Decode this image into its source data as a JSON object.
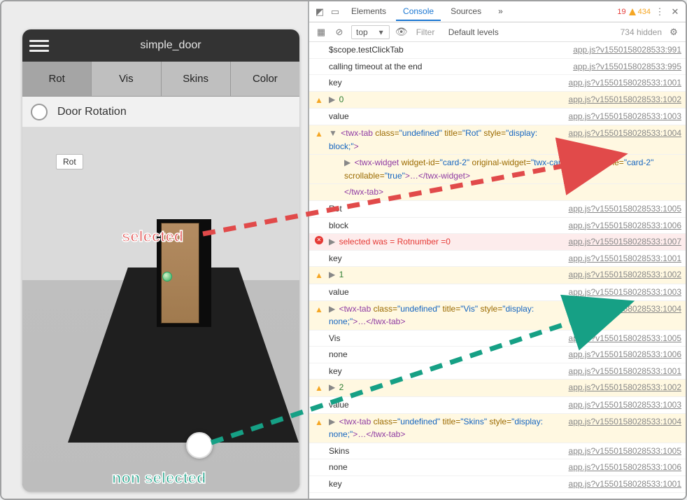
{
  "app": {
    "title": "simple_door",
    "tabs": [
      "Rot",
      "Vis",
      "Skins",
      "Color"
    ],
    "active_tab_index": 0,
    "section_label": "Door Rotation",
    "tooltip": "Rot"
  },
  "annotations": {
    "selected": "selected",
    "non_selected": "non selected"
  },
  "devtools": {
    "tabs": [
      "Elements",
      "Console",
      "Sources"
    ],
    "active_tab_index": 1,
    "more_label": "»",
    "errors": "19",
    "warnings": "434",
    "toolbar": {
      "context": "top",
      "filter_placeholder": "Filter",
      "levels": "Default levels",
      "hidden": "734 hidden"
    },
    "src_prefix": "app.js?v1550158028533",
    "rows": [
      {
        "type": "log",
        "msg": "$scope.testClickTab",
        "line": "991"
      },
      {
        "type": "log",
        "msg": "calling timeout at the end",
        "line": "995"
      },
      {
        "type": "log",
        "msg": "key",
        "line": "1001"
      },
      {
        "type": "warn",
        "caret": "▶",
        "segments": [
          {
            "t": "num",
            "v": "0"
          }
        ],
        "line": "1002"
      },
      {
        "type": "log",
        "msg": "value",
        "line": "1003"
      },
      {
        "type": "warn",
        "caret": "▼",
        "line": "1004",
        "html_segments": [
          "<",
          "twx-tab",
          " class=",
          "\"undefined\"",
          " title=",
          "\"Rot\"",
          " style=",
          "\"display: block;\"",
          ">"
        ],
        "children": [
          {
            "caret": "▶",
            "html_segments": [
              "<",
              "twx-widget",
              " widget-id=",
              "\"card-2\"",
              " original-widget=",
              "\"twx-card\"",
              " widget-name=",
              "\"card-2\"",
              " scrollable=",
              "\"true\"",
              ">",
              "…",
              "</",
              "twx-widget",
              ">"
            ]
          },
          {
            "html_segments": [
              "</",
              "twx-tab",
              ">"
            ]
          }
        ]
      },
      {
        "type": "log",
        "msg": "Rot",
        "line": "1005"
      },
      {
        "type": "log",
        "msg": "block",
        "line": "1006"
      },
      {
        "type": "err",
        "caret": "▶",
        "msg": "selected was = Rotnumber =0",
        "line": "1007"
      },
      {
        "type": "log",
        "msg": "key",
        "line": "1001"
      },
      {
        "type": "warn",
        "caret": "▶",
        "segments": [
          {
            "t": "num",
            "v": "1"
          }
        ],
        "line": "1002"
      },
      {
        "type": "log",
        "msg": "value",
        "line": "1003"
      },
      {
        "type": "warn",
        "caret": "▶",
        "line": "1004",
        "html_segments": [
          "<",
          "twx-tab",
          " class=",
          "\"undefined\"",
          " title=",
          "\"Vis\"",
          " style=",
          "\"display: none;\"",
          ">",
          "…",
          "</",
          "twx-tab",
          ">"
        ]
      },
      {
        "type": "log",
        "msg": "Vis",
        "line": "1005"
      },
      {
        "type": "log",
        "msg": "none",
        "line": "1006"
      },
      {
        "type": "log",
        "msg": "key",
        "line": "1001"
      },
      {
        "type": "warn",
        "caret": "▶",
        "segments": [
          {
            "t": "num",
            "v": "2"
          }
        ],
        "line": "1002"
      },
      {
        "type": "log",
        "msg": "value",
        "line": "1003"
      },
      {
        "type": "warn",
        "caret": "▶",
        "line": "1004",
        "html_segments": [
          "<",
          "twx-tab",
          " class=",
          "\"undefined\"",
          " title=",
          "\"Skins\"",
          " style=",
          "\"display: none;\"",
          ">",
          "…",
          "</",
          "twx-tab",
          ">"
        ]
      },
      {
        "type": "log",
        "msg": "Skins",
        "line": "1005"
      },
      {
        "type": "log",
        "msg": "none",
        "line": "1006"
      },
      {
        "type": "log",
        "msg": "key",
        "line": "1001"
      }
    ]
  }
}
